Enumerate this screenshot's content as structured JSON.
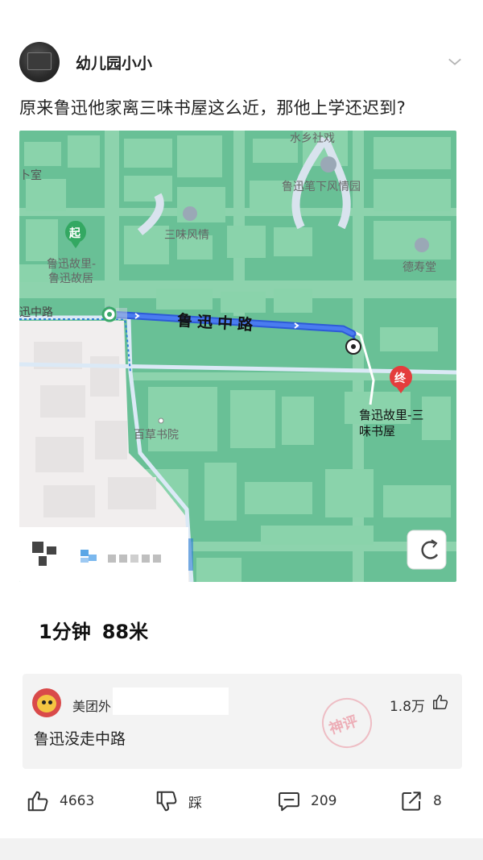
{
  "post": {
    "author": "幼儿园小小",
    "title": "原来鲁迅他家离三味书屋这么近，那他上学还迟到?"
  },
  "map": {
    "labels": {
      "shuixiang": "水乡社戏",
      "biyuan": "鲁迅笔下风情园",
      "xiaoshi": "卜室",
      "sanweifengqing": "三味风情",
      "shoutang": "德寿堂",
      "start_badge": "起",
      "start_name_1": "鲁迅故里-",
      "start_name_2": "鲁迅故居",
      "road_left": "迅中路",
      "road_main": "鲁迅中路",
      "end_badge": "终",
      "end_name_1": "鲁迅故里-三",
      "end_name_2": "味书屋",
      "baicao": "百草书院"
    }
  },
  "route": {
    "time": "1分钟",
    "distance": "88米"
  },
  "comment": {
    "user": "美团外",
    "likes": "1.8万",
    "text": "鲁迅没走中路",
    "stamp": "神评"
  },
  "actions": {
    "likes": "4663",
    "dislike": "踩",
    "comments": "209",
    "shares": "8"
  }
}
